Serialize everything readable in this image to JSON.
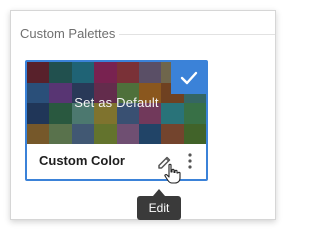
{
  "section": {
    "title": "Custom Palettes"
  },
  "palette_card": {
    "name": "Custom Color",
    "overlay_label": "Set as Default",
    "selected": true,
    "accent_color": "#3b82d8",
    "swatches": [
      "#7a2f3c",
      "#2f6f6d",
      "#2b8aa2",
      "#a7306f",
      "#a9444d",
      "#7d6e8e",
      "#9a8e6a",
      "#7d8a4a",
      "#3b6ea8",
      "#7b4aa0",
      "#3a4f7a",
      "#8a3d6a",
      "#6c9c53",
      "#c0792a",
      "#9a5a2e",
      "#4a8e8a",
      "#2d4b7a",
      "#3a7a58",
      "#6aa79a",
      "#b0a040",
      "#4f6f9f",
      "#9d4f7e",
      "#3aa0a8",
      "#4e9c62",
      "#a47a3b",
      "#7c9f6a",
      "#5a7aa0",
      "#8aa03f",
      "#9a6e9e",
      "#2f5f8f",
      "#a05f3f",
      "#5a8a3a"
    ]
  },
  "icons": {
    "edit": "pencil-icon",
    "more": "more-vertical-icon",
    "check": "checkmark-icon",
    "cursor": "hand-pointer-icon"
  },
  "tooltip": {
    "text": "Edit"
  }
}
